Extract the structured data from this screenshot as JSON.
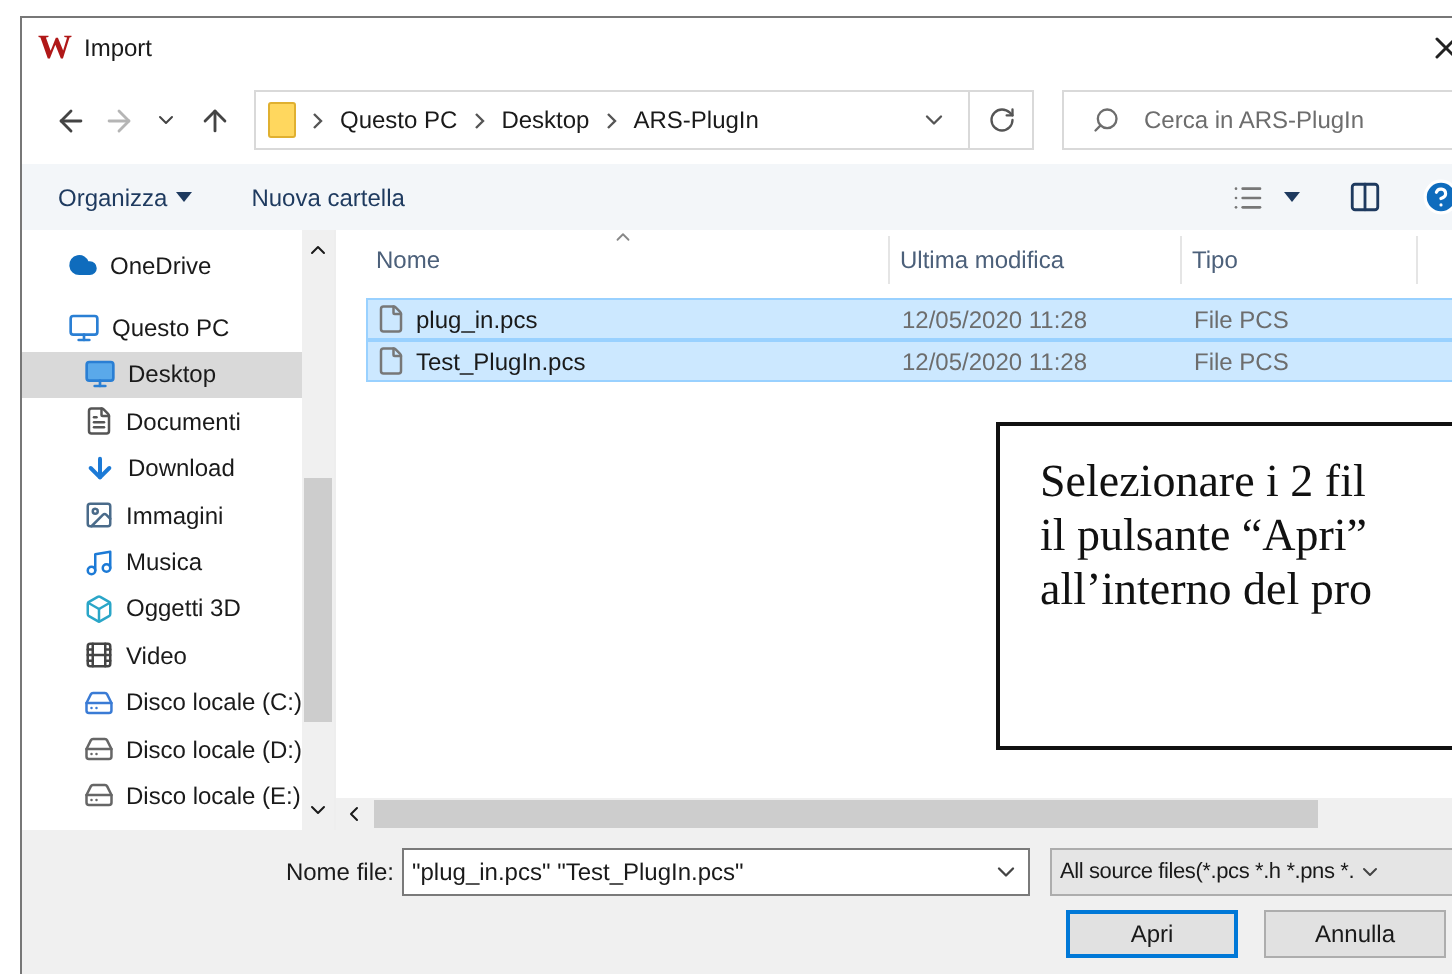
{
  "window": {
    "logo_text": "W",
    "title": "Import"
  },
  "navigation": {
    "path": [
      "Questo PC",
      "Desktop",
      "ARS-PlugIn"
    ],
    "search": {
      "placeholder": "Cerca in ARS-PlugIn"
    }
  },
  "command_bar": {
    "items": [
      {
        "label": "Organizza",
        "kind": "menu"
      },
      {
        "label": "Nuova cartella",
        "kind": "button"
      }
    ]
  },
  "sidebar": {
    "items": [
      {
        "label": "OneDrive",
        "kind": "cloud",
        "selected": false
      },
      {
        "label": "Questo PC",
        "kind": "computer",
        "selected": false,
        "children": [
          {
            "label": "Desktop",
            "kind": "desktop",
            "selected": true
          },
          {
            "label": "Documenti",
            "kind": "documents",
            "selected": false
          },
          {
            "label": "Download",
            "kind": "download",
            "selected": false
          },
          {
            "label": "Immagini",
            "kind": "images",
            "selected": false
          },
          {
            "label": "Musica",
            "kind": "music",
            "selected": false
          },
          {
            "label": "Oggetti 3D",
            "kind": "objects",
            "selected": false
          },
          {
            "label": "Video",
            "kind": "video",
            "selected": false
          },
          {
            "label": "Disco locale (C:)",
            "kind": "system-drive",
            "selected": false
          },
          {
            "label": "Disco locale (D:)",
            "kind": "drive",
            "selected": false
          },
          {
            "label": "Disco locale (E:)",
            "kind": "drive",
            "selected": false
          }
        ]
      }
    ]
  },
  "table": {
    "columns": [
      "Nome",
      "Ultima modifica",
      "Tipo"
    ],
    "rows": [
      {
        "name": "plug_in.pcs",
        "modified": "12/05/2020 11:28",
        "type": "File PCS",
        "selected": true
      },
      {
        "name": "Test_PlugIn.pcs",
        "modified": "12/05/2020 11:28",
        "type": "File PCS",
        "selected": true
      }
    ]
  },
  "callout": {
    "lines": [
      "Selezionare i 2 fil",
      "il pulsante “Apri”",
      "all’interno del pro"
    ]
  },
  "footer": {
    "file_name_label": "Nome file:",
    "file_name": "\"plug_in.pcs\" \"Test_PlugIn.pcs\"",
    "filter": "All source files(*.pcs *.h *.pns *.",
    "buttons": [
      {
        "label": "Apri",
        "kind": "primary"
      },
      {
        "label": "Annulla",
        "kind": "secondary"
      }
    ]
  }
}
